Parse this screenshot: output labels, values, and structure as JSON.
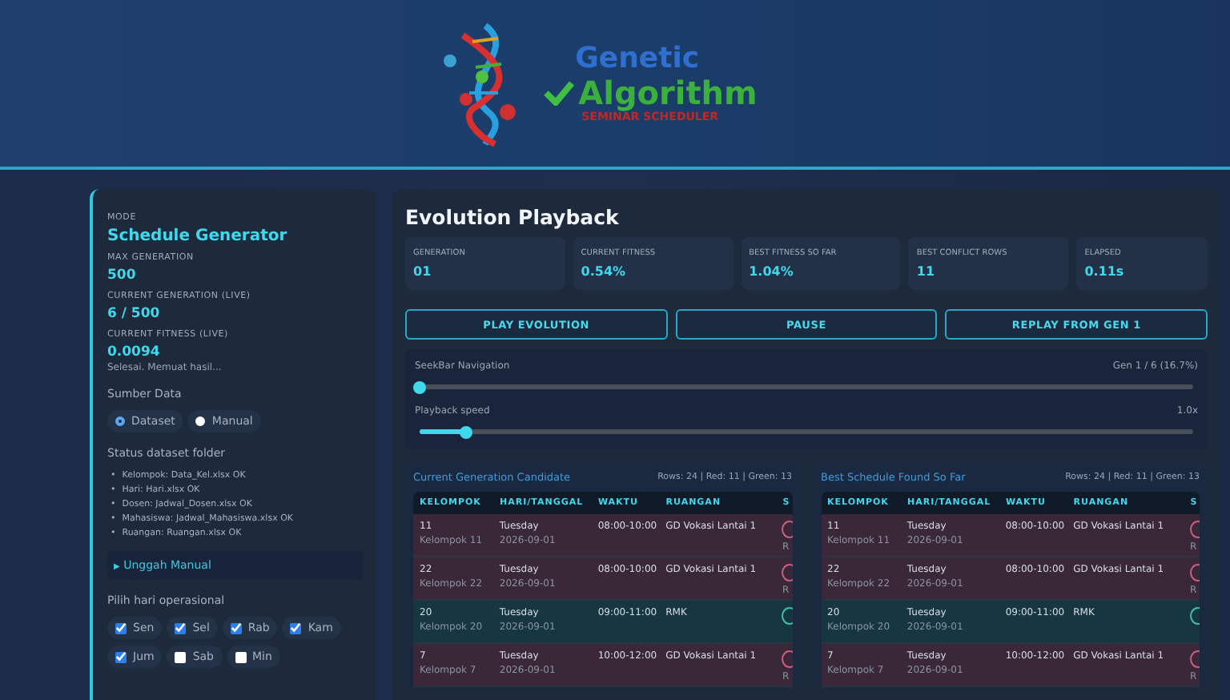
{
  "logo": {
    "line_1": "Genetic",
    "line_2": "Algorithm",
    "tagline": "SEMINAR SCHEDULER"
  },
  "sidebar": {
    "fields": [
      {
        "label": "MODE",
        "value": "Schedule Generator",
        "kind": "title"
      },
      {
        "label": "MAX GENERATION",
        "value": "500",
        "kind": "value"
      },
      {
        "label": "CURRENT GENERATION (LIVE)",
        "value": "6 / 500",
        "kind": "value"
      },
      {
        "label": "CURRENT FITNESS (LIVE)",
        "value": "0.0094",
        "kind": "value"
      }
    ],
    "status_message": "Selesai. Memuat hasil...",
    "source_label": "Sumber Data",
    "sources": [
      {
        "label": "Dataset",
        "selected": true
      },
      {
        "label": "Manual",
        "selected": false
      }
    ],
    "dataset_status_label": "Status dataset folder",
    "dataset_status": [
      {
        "marker": "•",
        "text": "Kelompok: Data_Kel.xlsx OK"
      },
      {
        "marker": "•",
        "text": "Hari: Hari.xlsx OK"
      },
      {
        "marker": "•",
        "text": "Dosen: Jadwal_Dosen.xlsx OK"
      },
      {
        "marker": "•",
        "text": "Mahasiswa: Jadwal_Mahasiswa.xlsx OK"
      },
      {
        "marker": "•",
        "text": "Ruangan: Ruangan.xlsx OK"
      }
    ],
    "manual_upload": {
      "label": "Unggah Manual",
      "marker": "▶",
      "expanded": false
    },
    "days_label": "Pilih hari operasional",
    "days": [
      {
        "label": "Sen",
        "checked": true
      },
      {
        "label": "Sel",
        "checked": true
      },
      {
        "label": "Rab",
        "checked": true
      },
      {
        "label": "Kam",
        "checked": true
      },
      {
        "label": "Jum",
        "checked": true
      },
      {
        "label": "Sab",
        "checked": false
      },
      {
        "label": "Min",
        "checked": false
      }
    ]
  },
  "playback": {
    "title": "Evolution Playback",
    "stats": [
      {
        "label": "GENERATION",
        "value": "01"
      },
      {
        "label": "CURRENT FITNESS",
        "value": "0.54%"
      },
      {
        "label": "BEST FITNESS SO FAR",
        "value": "1.04%"
      },
      {
        "label": "BEST CONFLICT ROWS",
        "value": "11"
      },
      {
        "label": "ELAPSED",
        "value": "0.11s"
      }
    ],
    "buttons": [
      "PLAY EVOLUTION",
      "PAUSE",
      "REPLAY FROM GEN 1"
    ],
    "sliders": [
      {
        "label": "SeekBar Navigation",
        "reading": "Gen 1 / 6 (16.7%)",
        "level": 0.0
      },
      {
        "label": "Playback speed",
        "reading": "1.0x",
        "level": 0.06
      }
    ]
  },
  "tables": [
    {
      "title": "Current Generation Candidate",
      "summary": "Rows: 24 | Red: 11 | Green: 13",
      "columns": [
        "KELOMPOK",
        "HARI/TANGGAL",
        "WAKTU",
        "RUANGAN",
        "S"
      ],
      "rows": [
        {
          "kind": "conflict",
          "id": "11",
          "group": "Kelompok 11",
          "day": "Tuesday",
          "date": "2026-09-01",
          "time": "08:00-10:00",
          "room": "GD Vokasi Lantai 1",
          "status": "R"
        },
        {
          "kind": "conflict",
          "id": "22",
          "group": "Kelompok 22",
          "day": "Tuesday",
          "date": "2026-09-01",
          "time": "08:00-10:00",
          "room": "GD Vokasi Lantai 1",
          "status": "R"
        },
        {
          "kind": "ok",
          "id": "20",
          "group": "Kelompok 20",
          "day": "Tuesday",
          "date": "2026-09-01",
          "time": "09:00-11:00",
          "room": "RMK"
        },
        {
          "kind": "conflict",
          "id": "7",
          "group": "Kelompok 7",
          "day": "Tuesday",
          "date": "2026-09-01",
          "time": "10:00-12:00",
          "room": "GD Vokasi Lantai 1",
          "status": "R"
        }
      ]
    },
    {
      "title": "Best Schedule Found So Far",
      "summary": "Rows: 24 | Red: 11 | Green: 13",
      "columns": [
        "KELOMPOK",
        "HARI/TANGGAL",
        "WAKTU",
        "RUANGAN",
        "S"
      ],
      "rows": [
        {
          "kind": "conflict",
          "id": "11",
          "group": "Kelompok 11",
          "day": "Tuesday",
          "date": "2026-09-01",
          "time": "08:00-10:00",
          "room": "GD Vokasi Lantai 1",
          "status": "R"
        },
        {
          "kind": "conflict",
          "id": "22",
          "group": "Kelompok 22",
          "day": "Tuesday",
          "date": "2026-09-01",
          "time": "08:00-10:00",
          "room": "GD Vokasi Lantai 1",
          "status": "R"
        },
        {
          "kind": "ok",
          "id": "20",
          "group": "Kelompok 20",
          "day": "Tuesday",
          "date": "2026-09-01",
          "time": "09:00-11:00",
          "room": "RMK"
        },
        {
          "kind": "conflict",
          "id": "7",
          "group": "Kelompok 7",
          "day": "Tuesday",
          "date": "2026-09-01",
          "time": "10:00-12:00",
          "room": "GD Vokasi Lantai 1",
          "status": "R"
        }
      ]
    }
  ]
}
